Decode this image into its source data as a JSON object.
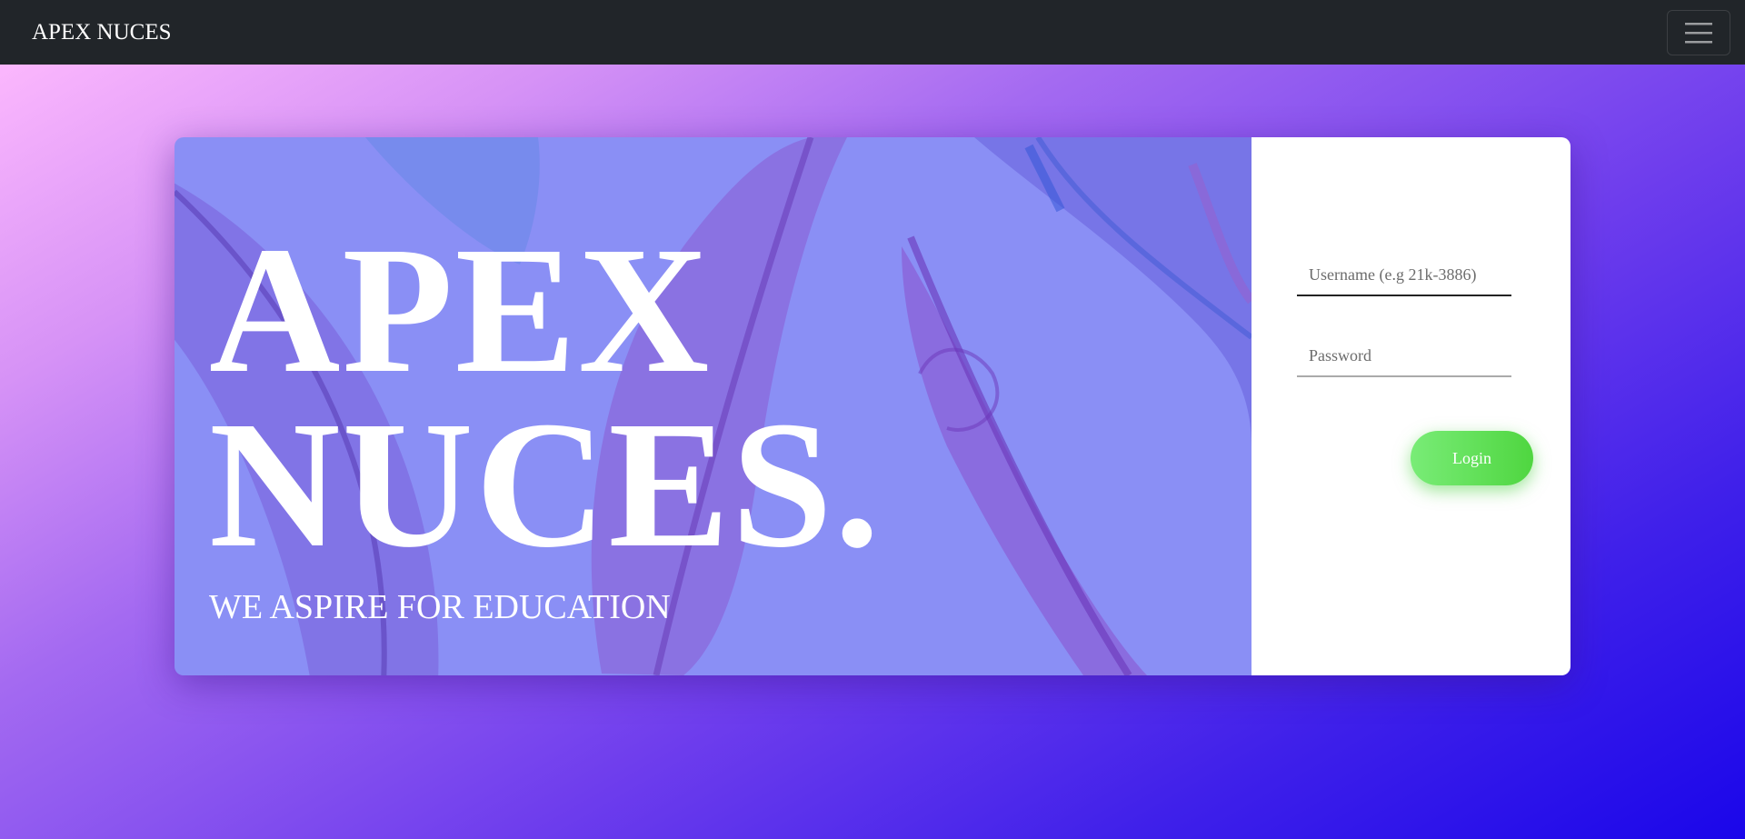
{
  "navbar": {
    "brand": "APEX NUCES",
    "menu_icon": "hamburger-menu-icon"
  },
  "hero": {
    "title_line1": "APEX",
    "title_line2": "NUCES.",
    "tagline": "WE ASPIRE FOR EDUCATION",
    "background": "feather-illustration"
  },
  "login_form": {
    "username_placeholder": "Username (e.g 21k-3886)",
    "username_value": "",
    "password_placeholder": "Password",
    "password_value": "",
    "login_label": "Login"
  },
  "colors": {
    "navbar_bg": "#212529",
    "hero_overlay": "#8a8ff5",
    "login_button": "#5fe055",
    "gradient_start": "#fbb7fd",
    "gradient_end": "#1a06ea"
  }
}
